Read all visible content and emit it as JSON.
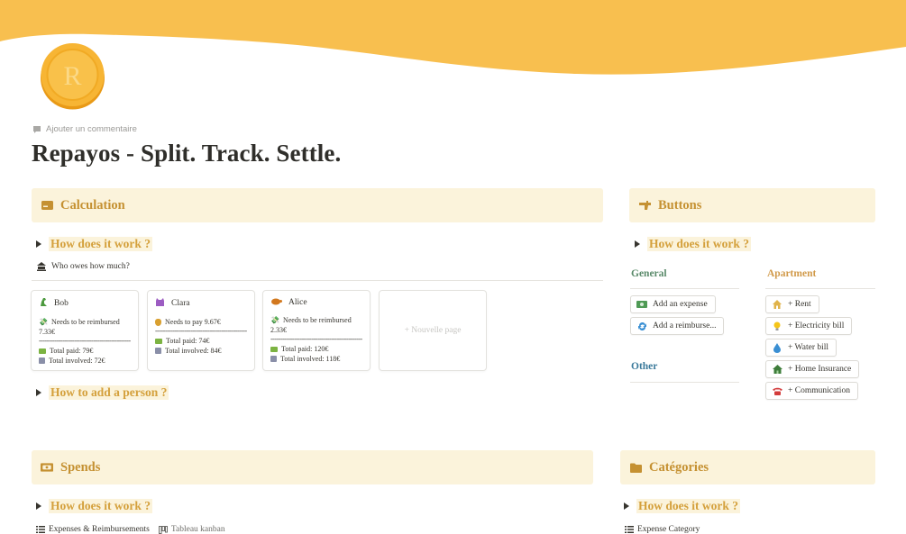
{
  "page": {
    "add_comment": "Ajouter un commentaire",
    "title": "Repayos - Split. Track. Settle.",
    "icon_letter": "R"
  },
  "colors": {
    "banner": "#f8bf4f",
    "accent": "#c59132",
    "callout_bg": "#fbf3db",
    "toggle_text": "#d4a03c"
  },
  "calculation": {
    "title": "Calculation",
    "how_it_works": "How does it work ?",
    "who_owes": "Who owes how much?",
    "cards": [
      {
        "name": "Bob",
        "icon": "dinosaur-icon",
        "status": "Needs to be reimbursed",
        "amount": "7.33€",
        "dashes": "-----------------------------------------------",
        "total_paid": "Total paid: 79€",
        "total_involved": "Total involved: 72€"
      },
      {
        "name": "Clara",
        "icon": "cat-icon",
        "status": "Needs to pay 9.67€",
        "amount": "",
        "dashes": "-----------------------------------------------",
        "total_paid": "Total paid: 74€",
        "total_involved": "Total involved: 84€"
      },
      {
        "name": "Alice",
        "icon": "turtle-icon",
        "status": "Needs to be reimbursed",
        "amount": "2.33€",
        "dashes": "-----------------------------------------------",
        "total_paid": "Total paid: 120€",
        "total_involved": "Total involved: 118€"
      }
    ],
    "new_page": "+ Nouvelle page",
    "how_to_add": "How to add a person ?"
  },
  "buttons": {
    "title": "Buttons",
    "how_it_works": "How does it work ?",
    "general": {
      "heading": "General",
      "items": [
        {
          "label": "Add an expense",
          "icon": "money-icon"
        },
        {
          "label": "Add a reimburse...",
          "icon": "refresh-icon"
        }
      ]
    },
    "other": {
      "heading": "Other"
    },
    "apartment": {
      "heading": "Apartment",
      "items": [
        {
          "label": "+ Rent",
          "icon": "house-icon"
        },
        {
          "label": "+ Electricity bill",
          "icon": "bulb-icon"
        },
        {
          "label": "+ Water bill",
          "icon": "droplet-icon"
        },
        {
          "label": "+ Home Insurance",
          "icon": "home-icon"
        },
        {
          "label": "+ Communication",
          "icon": "phone-icon"
        }
      ]
    }
  },
  "spends": {
    "title": "Spends",
    "how_it_works": "How does it work ?",
    "view1": "Expenses & Reimbursements",
    "view2": "Tableau kanban"
  },
  "categories": {
    "title": "Catégories",
    "how_it_works": "How does it work ?",
    "view1": "Expense Category"
  }
}
